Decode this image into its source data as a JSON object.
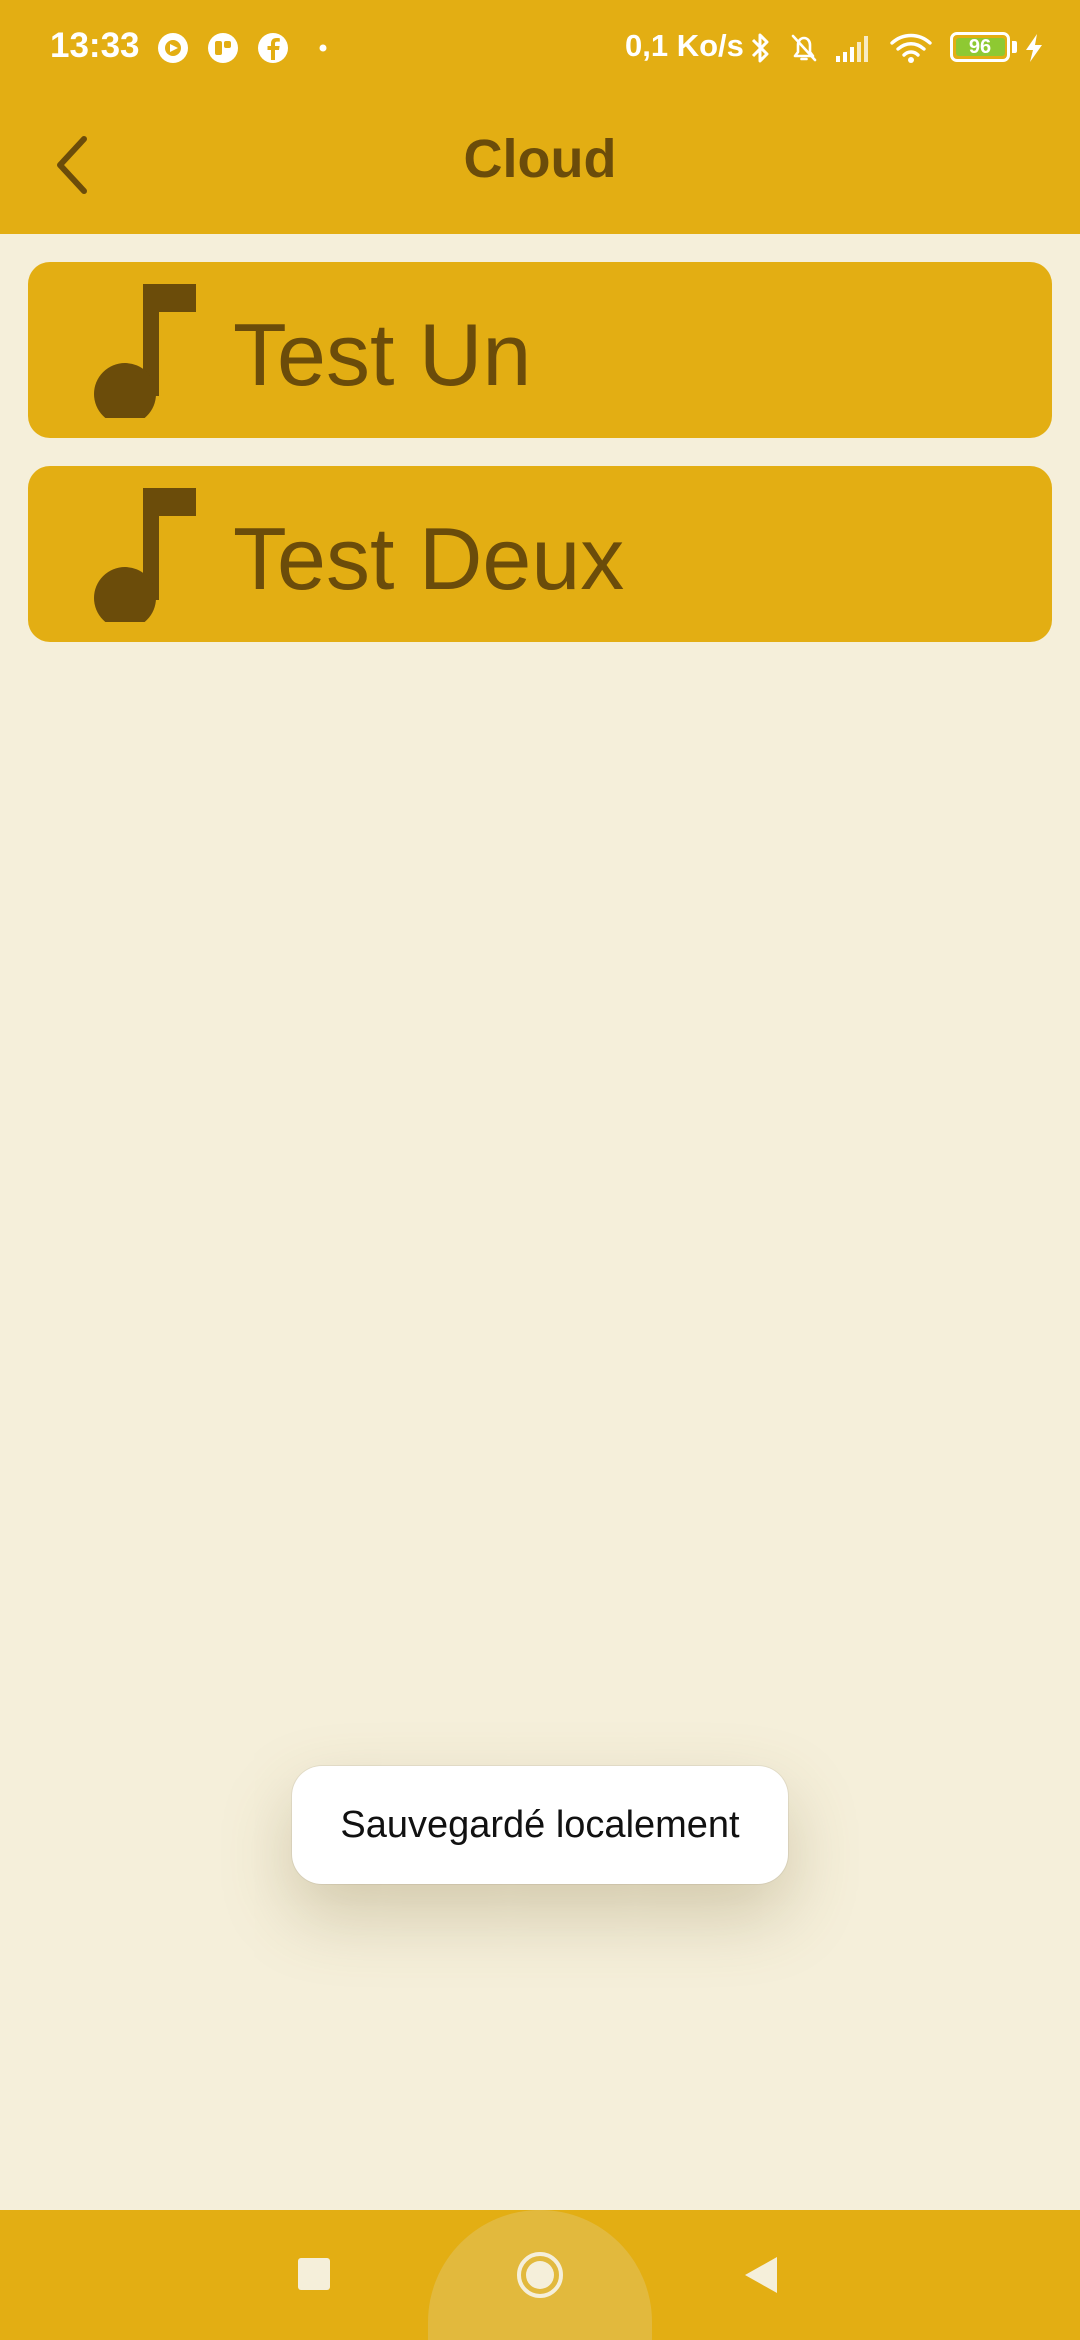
{
  "status_bar": {
    "time": "13:33",
    "network_speed": "0,1 Ko/s",
    "battery_level": "96",
    "icons": [
      "music-app-icon",
      "camera-app-icon",
      "facebook-icon",
      "notification-dot-icon",
      "bluetooth-icon",
      "mute-bell-icon",
      "signal-icon",
      "wifi-icon",
      "battery-icon",
      "charging-icon"
    ]
  },
  "header": {
    "title": "Cloud",
    "back_icon": "chevron-left-icon"
  },
  "list": {
    "items": [
      {
        "icon": "music-note-icon",
        "label": "Test Un"
      },
      {
        "icon": "music-note-icon",
        "label": "Test Deux"
      }
    ]
  },
  "toast": {
    "message": "Sauvegardé localement"
  },
  "nav_bar": {
    "icons": [
      "recents-square-icon",
      "home-circle-icon",
      "back-triangle-icon"
    ]
  },
  "colors": {
    "accent": "#e3ae13",
    "background": "#f5efda",
    "text_dark": "#6b4c0a",
    "battery_green": "#8ec932"
  }
}
